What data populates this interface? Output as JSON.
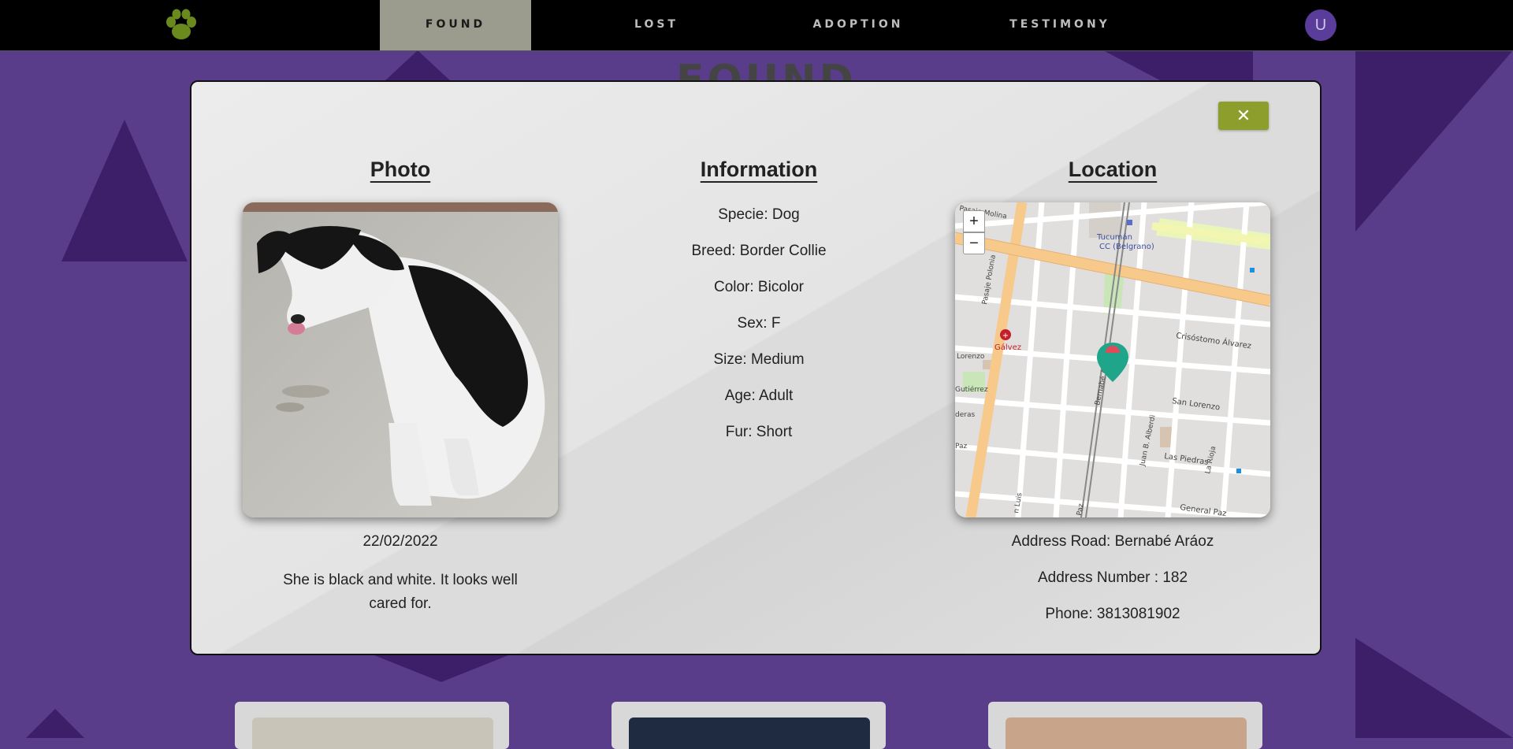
{
  "nav": {
    "items": [
      {
        "label": "FOUND",
        "active": true
      },
      {
        "label": "LOST",
        "active": false
      },
      {
        "label": "ADOPTION",
        "active": false
      },
      {
        "label": "TESTIMONY",
        "active": false
      }
    ],
    "avatar_initial": "U"
  },
  "background": {
    "page_title": "FOUND"
  },
  "modal": {
    "close_label": "✕",
    "photo": {
      "title": "Photo",
      "date": "22/02/2022",
      "description": "She is black and white. It looks well cared for."
    },
    "information": {
      "title": "Information",
      "lines": [
        "Specie: Dog",
        "Breed: Border Collie",
        "Color: Bicolor",
        "Sex: F",
        "Size: Medium",
        "Age: Adult",
        "Fur: Short"
      ]
    },
    "location": {
      "title": "Location",
      "zoom_in": "+",
      "zoom_out": "−",
      "map_labels": {
        "place1": "Tucumán",
        "place2": "CC (Belgrano)",
        "galvez": "Gálvez",
        "crisostomo": "Crisóstomo Álvarez",
        "san_lorenzo": "San Lorenzo",
        "las_piedras": "Las Piedras",
        "general_paz": "General Paz",
        "juan_alberdi": "Juan B. Alberdi",
        "la_rioja": "La Rioja",
        "bernabe": "Bernabé Ar",
        "pasaje": "Pasaje Polonia",
        "molina": "Pasaje Molina",
        "lorenzo": "Lorenzo",
        "gutierrez": "Gutiérrez",
        "deras": "deras",
        "paz": "Paz",
        "luis": "n Luis",
        "paz2": "Paz"
      },
      "address_road": "Address Road: Bernabé Aráoz",
      "address_number": "Address Number : 182",
      "phone": "Phone: 3813081902"
    }
  },
  "colors": {
    "accent": "#8e9e2c",
    "background": "#5a3d8a",
    "nav": "#000000",
    "active_tab": "#9b9b8e"
  }
}
